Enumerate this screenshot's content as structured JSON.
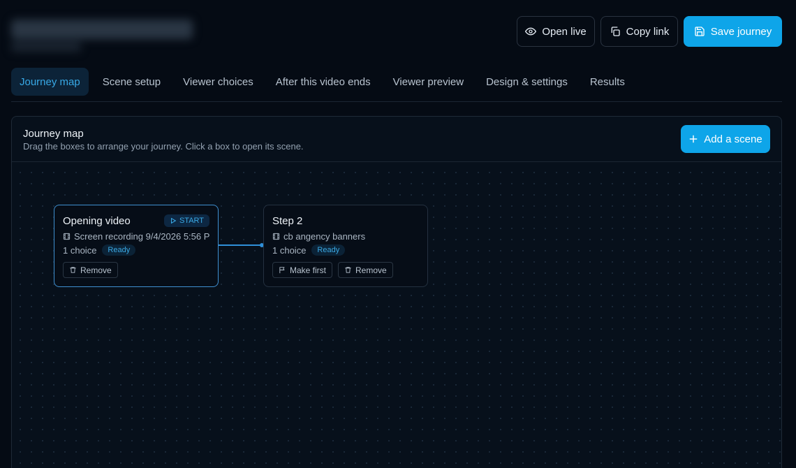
{
  "header": {
    "open_live_label": "Open live",
    "copy_link_label": "Copy link",
    "save_label": "Save journey"
  },
  "tabs": [
    {
      "label": "Journey map",
      "active": true
    },
    {
      "label": "Scene setup"
    },
    {
      "label": "Viewer choices"
    },
    {
      "label": "After this video ends"
    },
    {
      "label": "Viewer preview"
    },
    {
      "label": "Design & settings"
    },
    {
      "label": "Results"
    }
  ],
  "panel": {
    "title": "Journey map",
    "subtitle": "Drag the boxes to arrange your journey. Click a box to open its scene.",
    "add_label": "Add a scene"
  },
  "nodes": [
    {
      "title": "Opening video",
      "start_label": "START",
      "source": "Screen recording 9/4/2026 5:56 P",
      "choices": "1 choice",
      "status": "Ready",
      "remove_label": "Remove"
    },
    {
      "title": "Step 2",
      "source": "cb angency banners",
      "choices": "1 choice",
      "status": "Ready",
      "make_first_label": "Make first",
      "remove_label": "Remove"
    }
  ],
  "colors": {
    "background": "#050b14",
    "accent": "#0ea5e9",
    "active_tab_text": "#38a9e6"
  }
}
